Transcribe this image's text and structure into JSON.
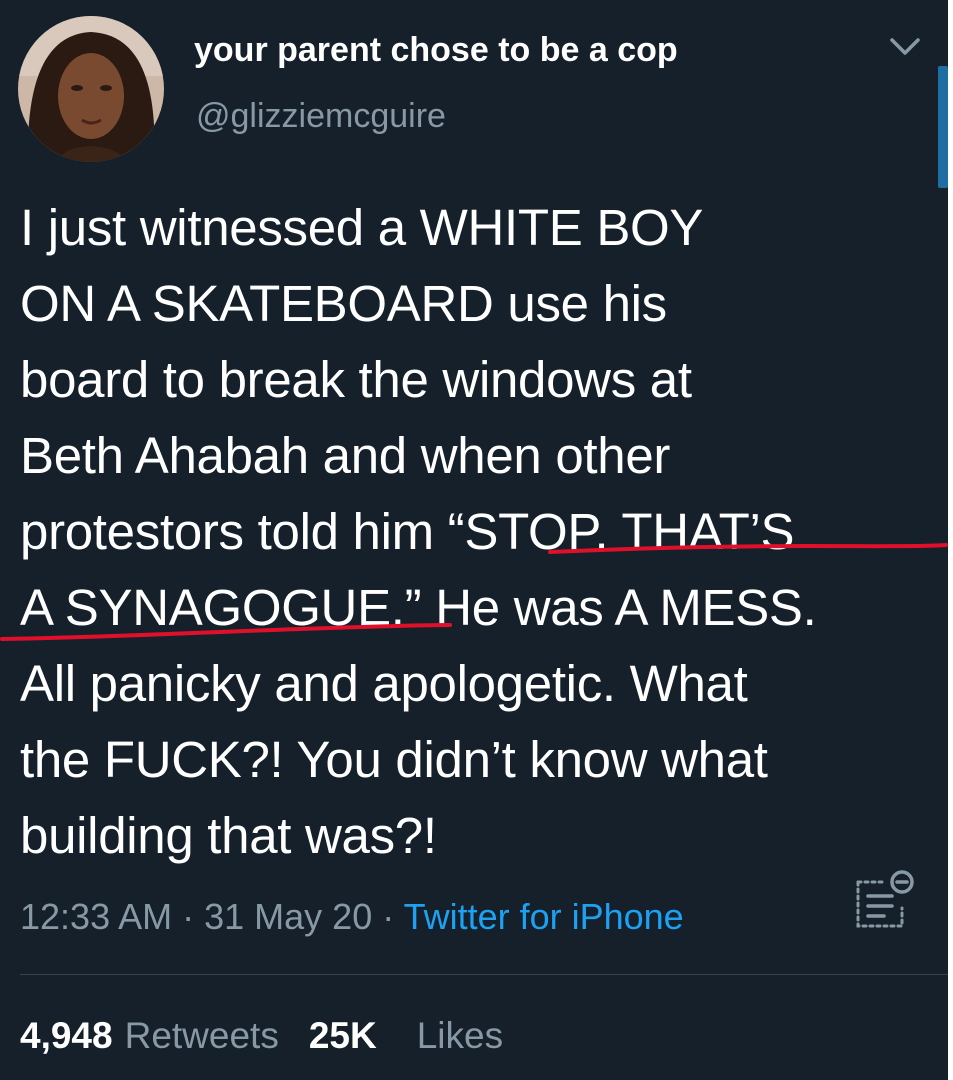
{
  "user": {
    "display_name": "your parent chose to be a cop",
    "handle": "@glizziemcguire"
  },
  "tweet": {
    "lines": [
      "I just witnessed a WHITE BOY",
      "ON A SKATEBOARD use his",
      "board to break the windows at",
      "Beth Ahabah and when other",
      "protestors told him “STOP. THAT’S",
      "A SYNAGOGUE.” He was A MESS.",
      "All panicky and apologetic. What",
      "the FUCK?! You didn’t know what",
      "building that was?!"
    ]
  },
  "meta": {
    "time": "12:33 AM",
    "separator": " · ",
    "date": "31 May 20",
    "source": "Twitter for iPhone"
  },
  "stats": {
    "retweets_count": "4,948",
    "retweets_label": "Retweets",
    "likes_count": "25K",
    "likes_label": "Likes"
  },
  "colors": {
    "background": "#15202b",
    "text_primary": "#ffffff",
    "text_secondary": "#8899a6",
    "accent": "#1da1f2",
    "underline": "#e0102a"
  },
  "icons": {
    "caret": "chevron-down-icon",
    "analytics": "analytics-icon"
  }
}
